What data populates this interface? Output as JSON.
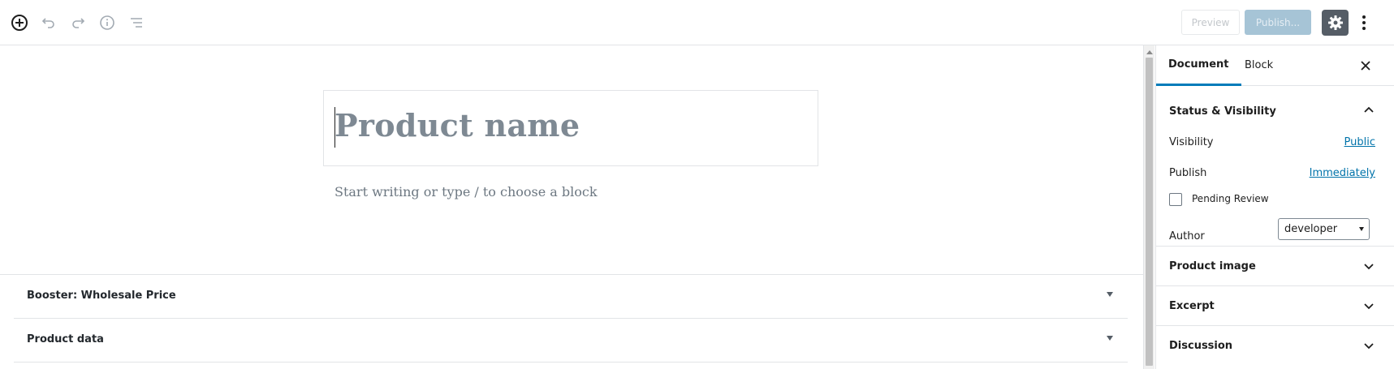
{
  "toolbar": {
    "add_block_icon": "plus-circle-icon",
    "undo_icon": "undo-icon",
    "redo_icon": "redo-icon",
    "info_icon": "info-icon",
    "outline_icon": "list-icon",
    "preview_label": "Preview",
    "publish_label": "Publish...",
    "settings_icon": "gear-icon",
    "more_icon": "vertical-ellipsis-icon"
  },
  "editor": {
    "title_placeholder": "Product name",
    "block_placeholder": "Start writing or type / to choose a block"
  },
  "metaboxes": [
    {
      "title": "Booster: Wholesale Price"
    },
    {
      "title": "Product data"
    }
  ],
  "sidebar": {
    "tabs": [
      {
        "label": "Document",
        "active": true
      },
      {
        "label": "Block",
        "active": false
      }
    ],
    "close_icon": "close-icon",
    "status_panel": {
      "title": "Status & Visibility",
      "visibility_label": "Visibility",
      "visibility_value": "Public",
      "publish_label": "Publish",
      "publish_value": "Immediately",
      "pending_review_label": "Pending Review",
      "pending_review_checked": false,
      "author_label": "Author",
      "author_value": "developer"
    },
    "panels": [
      {
        "title": "Product image"
      },
      {
        "title": "Excerpt"
      },
      {
        "title": "Discussion"
      }
    ]
  },
  "colors": {
    "accent": "#007cba",
    "link": "#0073aa",
    "publish_disabled": "#a6c4d6",
    "settings_active": "#555d66"
  }
}
